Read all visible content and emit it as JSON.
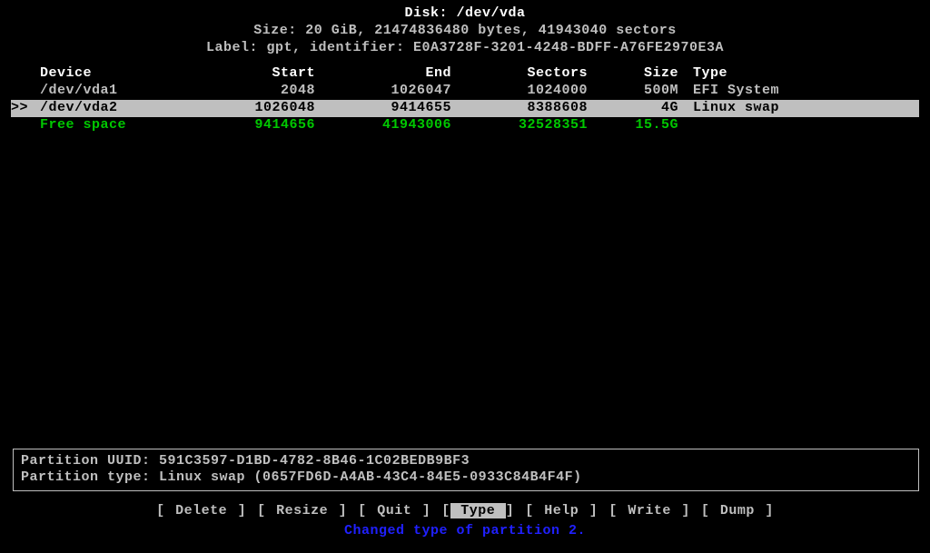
{
  "header": {
    "disk_label": "Disk: ",
    "disk_value": "/dev/vda",
    "size_line": "Size: 20 GiB, 21474836480 bytes, 41943040 sectors",
    "label_line": "Label: gpt, identifier: E0A3728F-3201-4248-BDFF-A76FE2970E3A"
  },
  "columns": {
    "device": "Device",
    "start": "Start",
    "end": "End",
    "sectors": "Sectors",
    "size": "Size",
    "type": "Type"
  },
  "rows": [
    {
      "pointer": "",
      "device": "/dev/vda1",
      "start": "2048",
      "end": "1026047",
      "sectors": "1024000",
      "size": "500M",
      "type": "EFI System",
      "selected": false,
      "free": false
    },
    {
      "pointer": ">>",
      "device": "/dev/vda2",
      "start": "1026048",
      "end": "9414655",
      "sectors": "8388608",
      "size": "4G",
      "type": "Linux swap",
      "selected": true,
      "free": false
    },
    {
      "pointer": "",
      "device": "Free space",
      "start": "9414656",
      "end": "41943006",
      "sectors": "32528351",
      "size": "15.5G",
      "type": "",
      "selected": false,
      "free": true
    }
  ],
  "info": {
    "uuid_line": "Partition UUID: 591C3597-D1BD-4782-8B46-1C02BEDB9BF3",
    "type_line": "Partition type: Linux swap (0657FD6D-A4AB-43C4-84E5-0933C84B4F4F)"
  },
  "menu": [
    {
      "label": "Delete",
      "highlighted": false
    },
    {
      "label": "Resize",
      "highlighted": false
    },
    {
      "label": " Quit ",
      "highlighted": false
    },
    {
      "label": " Type ",
      "highlighted": true
    },
    {
      "label": " Help ",
      "highlighted": false
    },
    {
      "label": " Write",
      "highlighted": false
    },
    {
      "label": " Dump ",
      "highlighted": false
    }
  ],
  "status": "Changed type of partition 2."
}
